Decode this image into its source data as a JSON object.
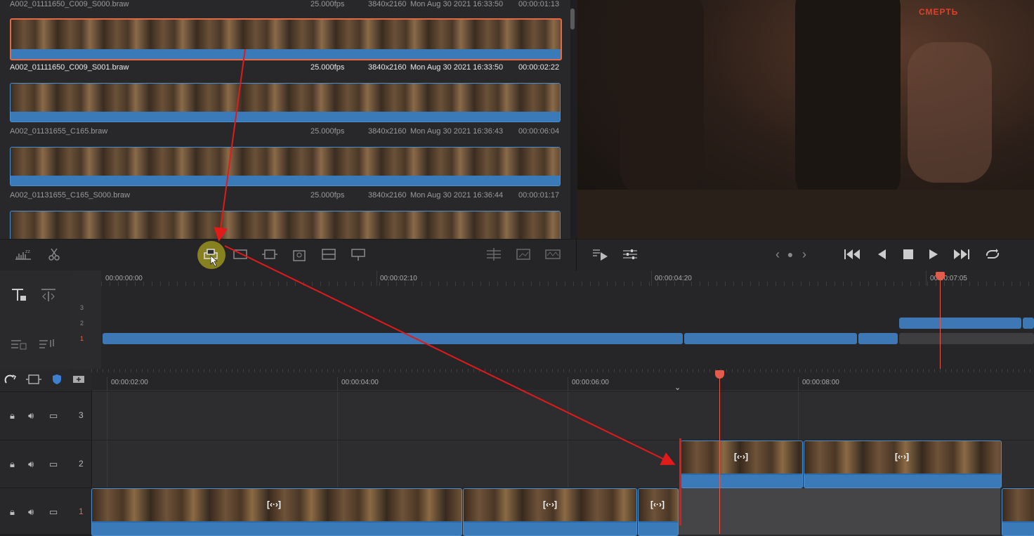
{
  "media_pool": {
    "clips": [
      {
        "name": "A002_01111650_C009_S000.braw",
        "fps": "25.000fps",
        "res": "3840x2160",
        "date": "Mon Aug 30 2021 16:33:50",
        "dur": "00:00:01:13",
        "selected": false
      },
      {
        "name": "A002_01111650_C009_S001.braw",
        "fps": "25.000fps",
        "res": "3840x2160",
        "date": "Mon Aug 30 2021 16:33:50",
        "dur": "00:00:02:22",
        "selected": true
      },
      {
        "name": "A002_01131655_C165.braw",
        "fps": "25.000fps",
        "res": "3840x2160",
        "date": "Mon Aug 30 2021 16:36:43",
        "dur": "00:00:06:04",
        "selected": false
      },
      {
        "name": "A002_01131655_C165_S000.braw",
        "fps": "25.000fps",
        "res": "3840x2160",
        "date": "Mon Aug 30 2021 16:36:44",
        "dur": "00:00:01:17",
        "selected": false
      }
    ]
  },
  "viewer": {
    "sign_text": "СМЕРТЬ"
  },
  "toolbar": {
    "icons": [
      "audio-waveform-zoom-icon",
      "scissors-icon",
      "smart-insert-icon",
      "append-icon",
      "ripple-overwrite-icon",
      "close-up-icon",
      "place-on-top-icon",
      "source-overwrite-icon",
      "split-icon",
      "safe-area-icon",
      "fullscreen-icon",
      "audio-meter-icon",
      "playback-mode-icon",
      "settings-sliders-icon"
    ],
    "transport": [
      "prev-marker-icon",
      "marker-dot-icon",
      "next-marker-icon",
      "go-to-start-icon",
      "play-reverse-icon",
      "stop-icon",
      "play-icon",
      "go-to-end-icon",
      "loop-icon"
    ]
  },
  "upper_timeline": {
    "timecodes": [
      "00:00:00:00",
      "00:00:02:10",
      "00:00:04:20",
      "00:00:07:05"
    ],
    "track_numbers": [
      "3",
      "2",
      "1"
    ]
  },
  "lower_timeline": {
    "timecodes": [
      "00:00:02:00",
      "00:00:04:00",
      "00:00:06:00",
      "00:00:08:00"
    ],
    "tracks": [
      {
        "number": "3"
      },
      {
        "number": "2"
      },
      {
        "number": "1"
      }
    ],
    "head_icons": [
      "snap-icon",
      "zoom-fit-icon",
      "shield-icon",
      "add-track-icon"
    ],
    "fx_label": "[‹·›]"
  },
  "colors": {
    "accent": "#3a7ab8",
    "playhead": "#e35b4a",
    "selection": "#e36a45",
    "annotation": "#e11a1a"
  }
}
